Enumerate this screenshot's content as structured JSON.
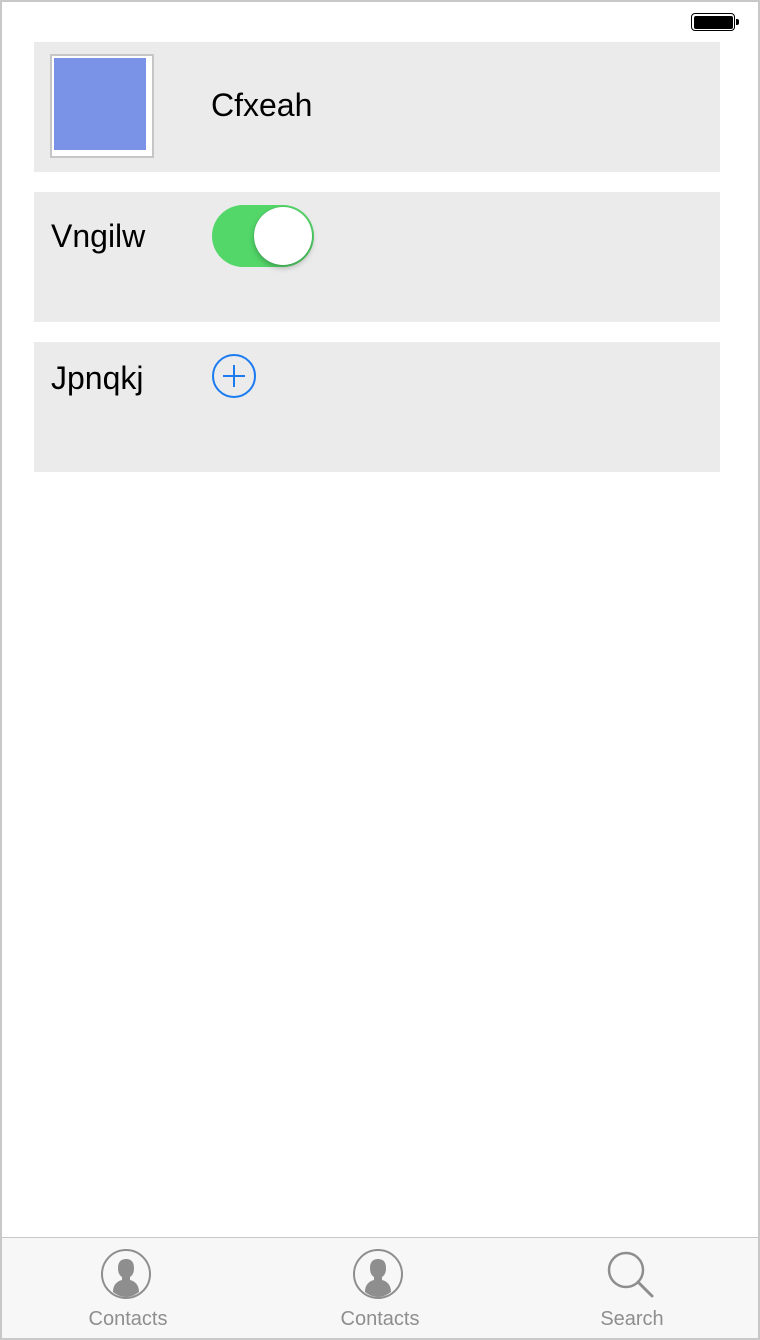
{
  "status_bar": {
    "battery_icon": "battery-full-icon"
  },
  "cells": [
    {
      "title": "Cfxeah",
      "swatch_color": "#7b93e6",
      "swatch_border_color": "#c6c6c6"
    },
    {
      "title": "Vngilw",
      "toggle_on": true,
      "toggle_color": "#53d769"
    },
    {
      "title": "Jpnqkj",
      "add_icon": "plus-circle-icon",
      "accent_color": "#1b7cf2"
    }
  ],
  "cell_background": "#ebebeb",
  "tab_bar": {
    "tabs": [
      {
        "label": "Contacts",
        "icon": "contact-icon"
      },
      {
        "label": "Contacts",
        "icon": "contact-icon"
      },
      {
        "label": "Search",
        "icon": "search-icon"
      }
    ],
    "tint_color": "#8e8e8e"
  }
}
